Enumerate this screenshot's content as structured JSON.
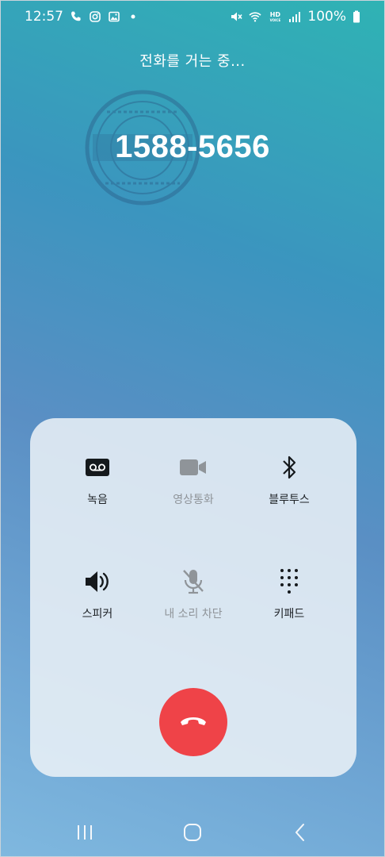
{
  "status_bar": {
    "time": "12:57",
    "battery": "100%",
    "hd_label": "HD",
    "voice_label": "VOICE",
    "left_icons": [
      "phone-icon",
      "instagram-icon",
      "image-icon",
      "dot-icon"
    ],
    "right_icons": [
      "mute-icon",
      "wifi-icon",
      "hd-voice-icon",
      "signal-icon",
      "battery-icon"
    ]
  },
  "call": {
    "status": "전화를 거는 중...",
    "number": "1588-5656"
  },
  "controls": [
    {
      "label": "녹음",
      "icon": "voicemail-icon",
      "enabled": true
    },
    {
      "label": "영상통화",
      "icon": "video-camera-icon",
      "enabled": false
    },
    {
      "label": "블루투스",
      "icon": "bluetooth-icon",
      "enabled": true
    },
    {
      "label": "스피커",
      "icon": "speaker-icon",
      "enabled": true
    },
    {
      "label": "내 소리 차단",
      "icon": "mic-off-icon",
      "enabled": false
    },
    {
      "label": "키패드",
      "icon": "keypad-icon",
      "enabled": true
    }
  ],
  "end_call": {
    "icon": "end-call-icon",
    "color": "#ef4348"
  },
  "nav": {
    "icons": [
      "recent-apps-icon",
      "home-icon",
      "back-icon"
    ]
  },
  "colors": {
    "panel": "#ecf2f7",
    "label": "#1e2226",
    "disabled_label": "#8f9499"
  }
}
